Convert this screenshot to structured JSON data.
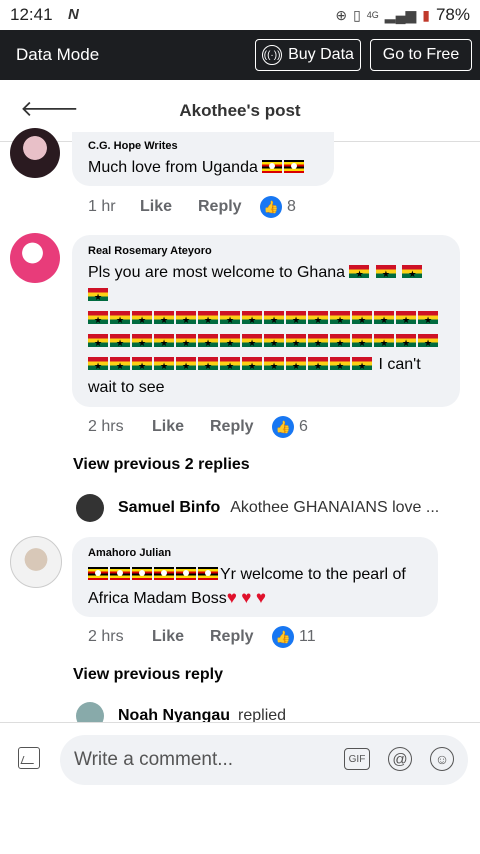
{
  "status": {
    "time": "12:41",
    "carrier_logo": "N",
    "network": "4G",
    "battery": "78%"
  },
  "data_mode": {
    "title": "Data Mode",
    "buy_label": "Buy Data",
    "free_label": "Go to Free"
  },
  "header": {
    "title": "Akothee's post"
  },
  "comments": [
    {
      "author": "C.G. Hope Writes",
      "text": "Much love from Uganda",
      "time": "1 hr",
      "like": "Like",
      "reply": "Reply",
      "count": "8"
    },
    {
      "author": "Real Rosemary Ateyoro",
      "text_start": "Pls you are most welcome to Ghana",
      "text_end": "I can't wait to see",
      "time": "2 hrs",
      "like": "Like",
      "reply": "Reply",
      "count": "6"
    },
    {
      "author": "Amahoro Julian",
      "text": "Yr welcome to the pearl of Africa Madam Boss",
      "time": "2 hrs",
      "like": "Like",
      "reply": "Reply",
      "count": "11"
    }
  ],
  "view_previous_2": "View previous 2 replies",
  "reply_preview": {
    "name": "Samuel Binfo",
    "text": "Akothee GHANAIANS love ..."
  },
  "view_previous_1": "View previous reply",
  "reply_preview_2": {
    "name": "Noah Nyangau",
    "text": "replied"
  },
  "composer": {
    "placeholder": "Write a comment...",
    "gif": "GIF"
  },
  "colors": {
    "brand": "#1877f2",
    "dark_bar": "#1c1e21"
  }
}
